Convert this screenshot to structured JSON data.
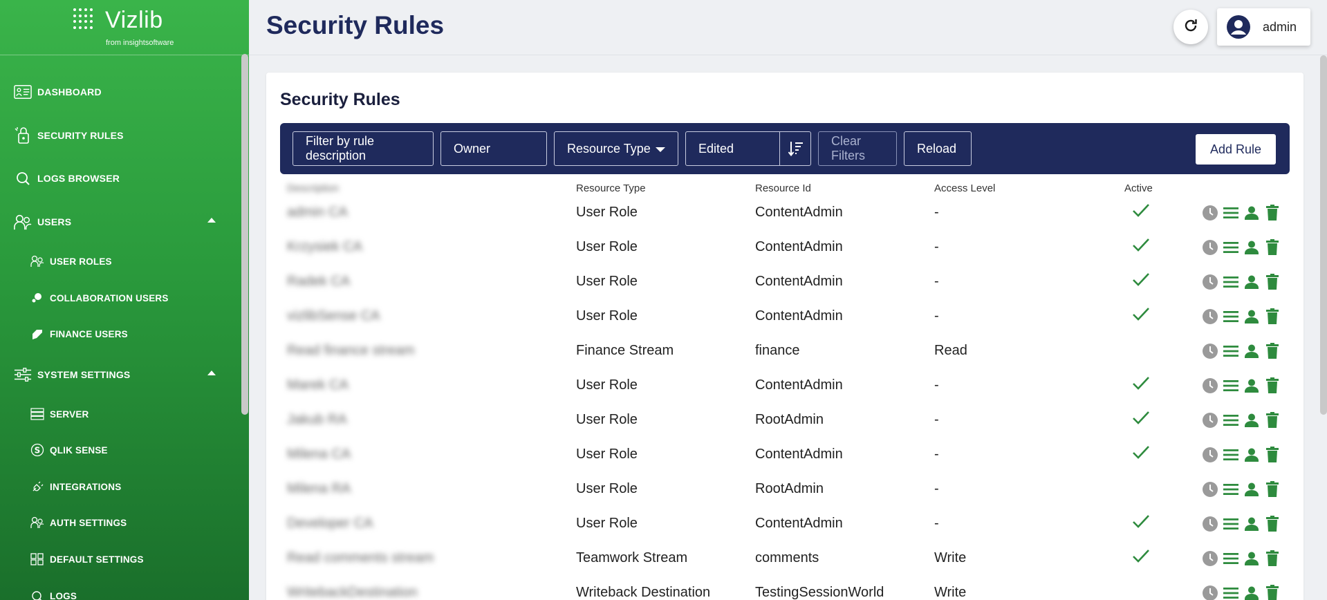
{
  "app": {
    "logo_text": "Vizlib",
    "logo_sub": "from insightsoftware"
  },
  "sidebar": {
    "items": [
      {
        "label": "DASHBOARD",
        "icon": "dashboard-icon"
      },
      {
        "label": "SECURITY RULES",
        "icon": "security-rules-icon"
      },
      {
        "label": "LOGS BROWSER",
        "icon": "search-icon"
      },
      {
        "label": "USERS",
        "icon": "users-icon",
        "expanded": true
      },
      {
        "label": "USER ROLES",
        "icon": "user-roles-icon"
      },
      {
        "label": "COLLABORATION USERS",
        "icon": "collaboration-icon"
      },
      {
        "label": "FINANCE USERS",
        "icon": "finance-icon"
      },
      {
        "label": "SYSTEM SETTINGS",
        "icon": "sliders-icon",
        "expanded": true
      },
      {
        "label": "SERVER",
        "icon": "server-icon"
      },
      {
        "label": "QLIK SENSE",
        "icon": "qlik-icon"
      },
      {
        "label": "INTEGRATIONS",
        "icon": "plug-icon"
      },
      {
        "label": "AUTH SETTINGS",
        "icon": "auth-icon"
      },
      {
        "label": "DEFAULT SETTINGS",
        "icon": "grid-icon"
      },
      {
        "label": "LOGS",
        "icon": "logs-icon"
      }
    ]
  },
  "header": {
    "title": "Security Rules",
    "username": "admin"
  },
  "card": {
    "title": "Security Rules"
  },
  "filters": {
    "description_placeholder": "Filter by rule description",
    "owner_placeholder": "Owner",
    "resource_type": "Resource Type",
    "sort_field": "Edited",
    "clear_label": "Clear Filters",
    "reload_label": "Reload",
    "add_label": "Add Rule"
  },
  "table": {
    "columns": [
      "Description",
      "Resource Type",
      "Resource Id",
      "Access Level",
      "Active"
    ],
    "rows": [
      {
        "description": "admin CA",
        "resource_type": "User Role",
        "resource_id": "ContentAdmin",
        "access": "-",
        "active": true
      },
      {
        "description": "Krzysiek CA",
        "resource_type": "User Role",
        "resource_id": "ContentAdmin",
        "access": "-",
        "active": true
      },
      {
        "description": "Radek CA",
        "resource_type": "User Role",
        "resource_id": "ContentAdmin",
        "access": "-",
        "active": true
      },
      {
        "description": "vizlibSense CA",
        "resource_type": "User Role",
        "resource_id": "ContentAdmin",
        "access": "-",
        "active": true
      },
      {
        "description": "Read finance stream",
        "resource_type": "Finance Stream",
        "resource_id": "finance",
        "access": "Read",
        "active": false
      },
      {
        "description": "Marek CA",
        "resource_type": "User Role",
        "resource_id": "ContentAdmin",
        "access": "-",
        "active": true
      },
      {
        "description": "Jakub RA",
        "resource_type": "User Role",
        "resource_id": "RootAdmin",
        "access": "-",
        "active": true
      },
      {
        "description": "Milena CA",
        "resource_type": "User Role",
        "resource_id": "ContentAdmin",
        "access": "-",
        "active": true
      },
      {
        "description": "Milena RA",
        "resource_type": "User Role",
        "resource_id": "RootAdmin",
        "access": "-",
        "active": false
      },
      {
        "description": "Developer CA",
        "resource_type": "User Role",
        "resource_id": "ContentAdmin",
        "access": "-",
        "active": true
      },
      {
        "description": "Read comments stream",
        "resource_type": "Teamwork Stream",
        "resource_id": "comments",
        "access": "Write",
        "active": true
      },
      {
        "description": "WritebackDestination",
        "resource_type": "Writeback Destination",
        "resource_id": "TestingSessionWorld",
        "access": "Write",
        "active": false
      }
    ]
  },
  "colors": {
    "sidebar_green": "#2a9a3c",
    "navy": "#1f2a5c",
    "action_green": "#2e8b3e",
    "check_green": "#2e8b3e",
    "history_gray": "#9a9a9a"
  }
}
